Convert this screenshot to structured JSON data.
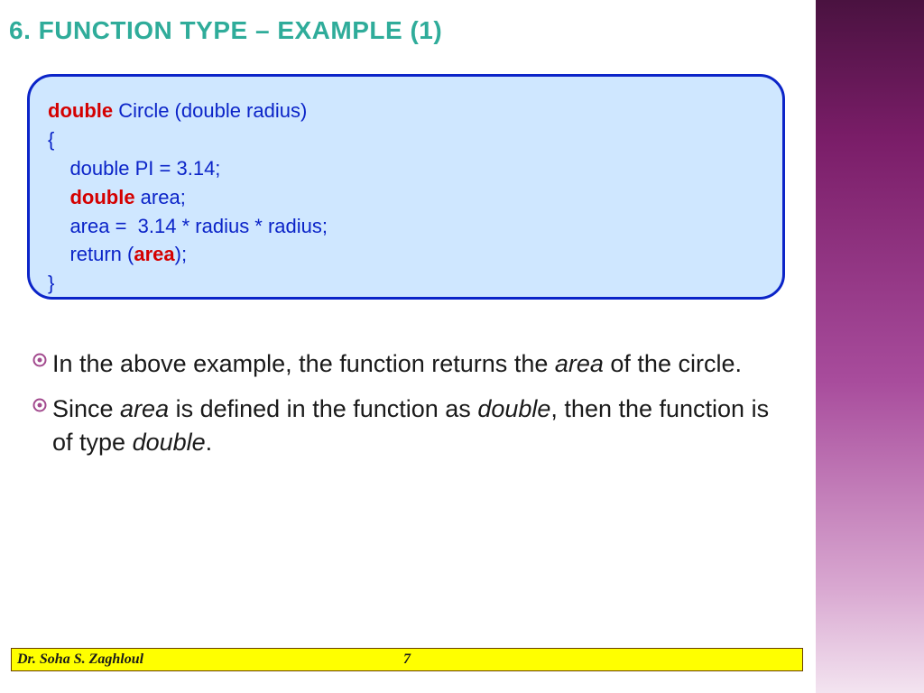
{
  "title": "6. FUNCTION TYPE – EXAMPLE (1)",
  "code": {
    "l1a": "double",
    "l1b": " Circle (double radius)",
    "l2": "{",
    "l3": "    double PI = 3.14;",
    "l4a": "    ",
    "l4b": "double",
    "l4c": " area;",
    "l5": "    area =  3.14 * radius * radius;",
    "l6a": "    return (",
    "l6b": "area",
    "l6c": ");",
    "l7": "}"
  },
  "bullets": {
    "b1_a": "In the above example, the function returns the ",
    "b1_i": "area",
    "b1_b": " of the circle.",
    "b2_a": "Since ",
    "b2_i1": "area",
    "b2_b": " is defined in the function as ",
    "b2_i2": "double",
    "b2_c": ", then the function is of type ",
    "b2_i3": "double",
    "b2_d": "."
  },
  "footer": {
    "author": "Dr. Soha S. Zaghloul",
    "page": "7"
  },
  "colors": {
    "accent": "#2fac9a",
    "codebox_border": "#0b24c8",
    "codebox_bg": "#cfe7ff",
    "highlight_red": "#d40000",
    "footer_bg": "#ffff00"
  }
}
